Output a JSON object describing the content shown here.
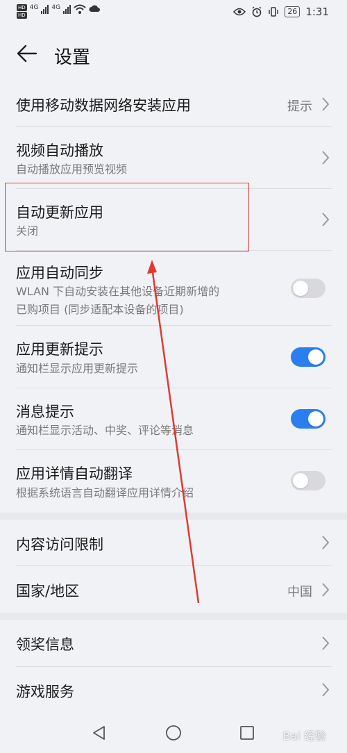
{
  "status_bar": {
    "left_hd1": "HD",
    "left_hd2": "HD",
    "signal1": "4G",
    "signal2": "4G",
    "battery": "26",
    "time": "1:31"
  },
  "header": {
    "title": "设置"
  },
  "rows": [
    {
      "title": "使用移动数据网络安装应用",
      "value": "提示"
    },
    {
      "title": "视频自动播放",
      "subtitle": "自动播放应用预览视频"
    },
    {
      "title": "自动更新应用",
      "subtitle": "关闭"
    },
    {
      "title": "应用自动同步",
      "subtitle_line1": "WLAN 下自动安装在其他设备近期新增的",
      "subtitle_line2": "已购项目 (同步适配本设备的项目)",
      "toggle": "off"
    },
    {
      "title": "应用更新提示",
      "subtitle": "通知栏显示应用更新提示",
      "toggle": "on"
    },
    {
      "title": "消息提示",
      "subtitle": "通知栏显示活动、中奖、评论等消息",
      "toggle": "on"
    },
    {
      "title": "应用详情自动翻译",
      "subtitle": "根据系统语言自动翻译应用详情介绍",
      "toggle": "off"
    },
    {
      "title": "内容访问限制"
    },
    {
      "title": "国家/地区",
      "value": "中国"
    },
    {
      "title": "领奖信息"
    },
    {
      "title": "游戏服务"
    }
  ],
  "colors": {
    "accent": "#2a7ff0",
    "highlight": "#e03a2e",
    "background": "#f1f2f6"
  },
  "watermark": "Bai 经验"
}
